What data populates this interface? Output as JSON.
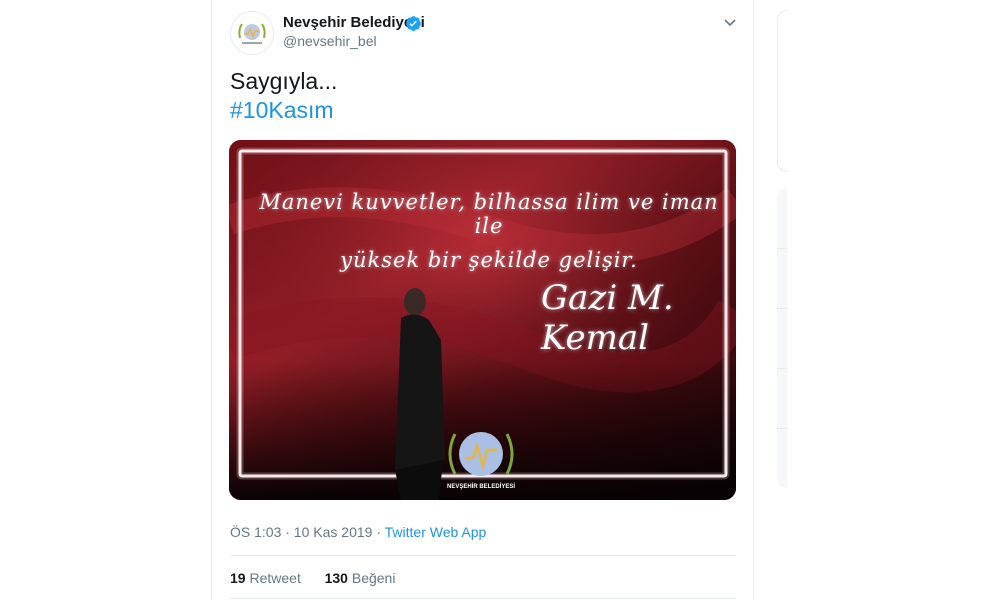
{
  "tweet": {
    "display_name": "Nevşehir Belediyesi",
    "handle": "@nevsehir_bel",
    "text_line1": "Saygıyla...",
    "hashtag": "#10Kasım",
    "timestamp": "ÖS 1:03 · 10 Kas 2019 ·",
    "source": "Twitter Web App",
    "retweet_count": "19",
    "retweet_label": "Retweet",
    "like_count": "130",
    "like_label": "Beğeni"
  },
  "media": {
    "quote_line1": "Manevi kuvvetler, bilhassa ilim ve iman ile",
    "quote_line2": "yüksek bir şekilde gelişir.",
    "signature": "Gazi M. Kemal",
    "logo_caption": "NEVŞEHİR BELEDİYESİ"
  },
  "colors": {
    "accent": "#1b95e0",
    "verified": "#1da1f2",
    "muted": "#657786"
  },
  "icons": [
    "verified-badge-icon",
    "chevron-down-icon"
  ]
}
